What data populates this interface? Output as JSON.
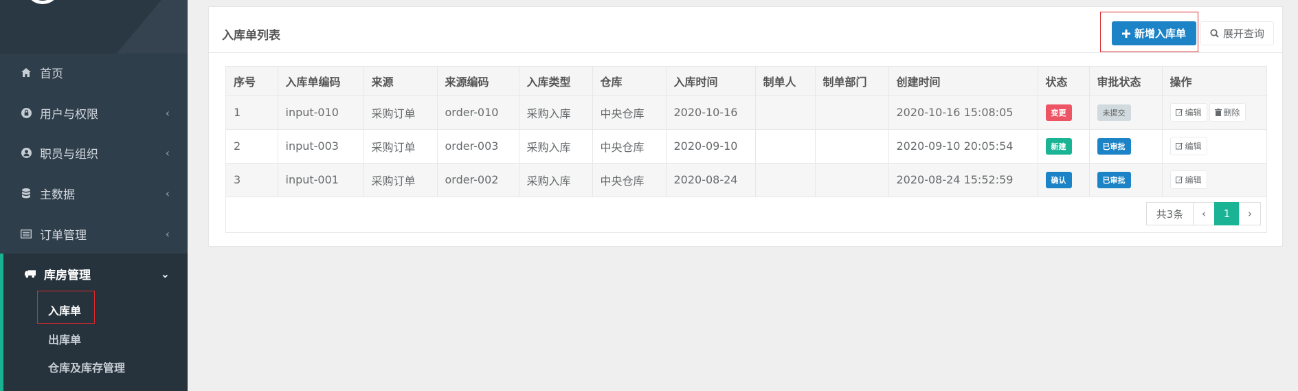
{
  "sidebar": {
    "items": [
      {
        "label": "首页",
        "icon": "home-icon"
      },
      {
        "label": "用户与权限",
        "icon": "lock-icon"
      },
      {
        "label": "职员与组织",
        "icon": "user-circle-icon"
      },
      {
        "label": "主数据",
        "icon": "database-icon"
      },
      {
        "label": "订单管理",
        "icon": "list-alt-icon"
      },
      {
        "label": "库房管理",
        "icon": "truck-icon"
      }
    ],
    "sub_items": [
      {
        "label": "入库单"
      },
      {
        "label": "出库单"
      },
      {
        "label": "仓库及库存管理"
      }
    ]
  },
  "panel": {
    "title": "入库单列表",
    "add_button": "新增入库单",
    "query_button": "展开查询"
  },
  "table": {
    "headers": [
      "序号",
      "入库单编码",
      "来源",
      "来源编码",
      "入库类型",
      "仓库",
      "入库时间",
      "制单人",
      "制单部门",
      "创建时间",
      "状态",
      "审批状态",
      "操作"
    ],
    "rows": [
      {
        "no": "1",
        "code": "input-010",
        "source": "采购订单",
        "source_code": "order-010",
        "type": "采购入库",
        "warehouse": "中央仓库",
        "in_time": "2020-10-16",
        "maker": "",
        "dept": "",
        "created": "2020-10-16 15:08:05",
        "status": "变更",
        "approval": "未提交",
        "edit": "编辑",
        "delete": "删除"
      },
      {
        "no": "2",
        "code": "input-003",
        "source": "采购订单",
        "source_code": "order-003",
        "type": "采购入库",
        "warehouse": "中央仓库",
        "in_time": "2020-09-10",
        "maker": "",
        "dept": "",
        "created": "2020-09-10 20:05:54",
        "status": "新建",
        "approval": "已审批",
        "edit": "编辑"
      },
      {
        "no": "3",
        "code": "input-001",
        "source": "采购订单",
        "source_code": "order-002",
        "type": "采购入库",
        "warehouse": "中央仓库",
        "in_time": "2020-08-24",
        "maker": "",
        "dept": "",
        "created": "2020-08-24 15:52:59",
        "status": "确认",
        "approval": "已审批",
        "edit": "编辑"
      }
    ]
  },
  "pager": {
    "total": "共3条",
    "prev": "‹",
    "current": "1",
    "next": "›"
  },
  "colors": {
    "accent": "#19b394",
    "primary": "#1c84c6",
    "danger": "#ed5565",
    "sidebar": "#2f3e4b"
  }
}
